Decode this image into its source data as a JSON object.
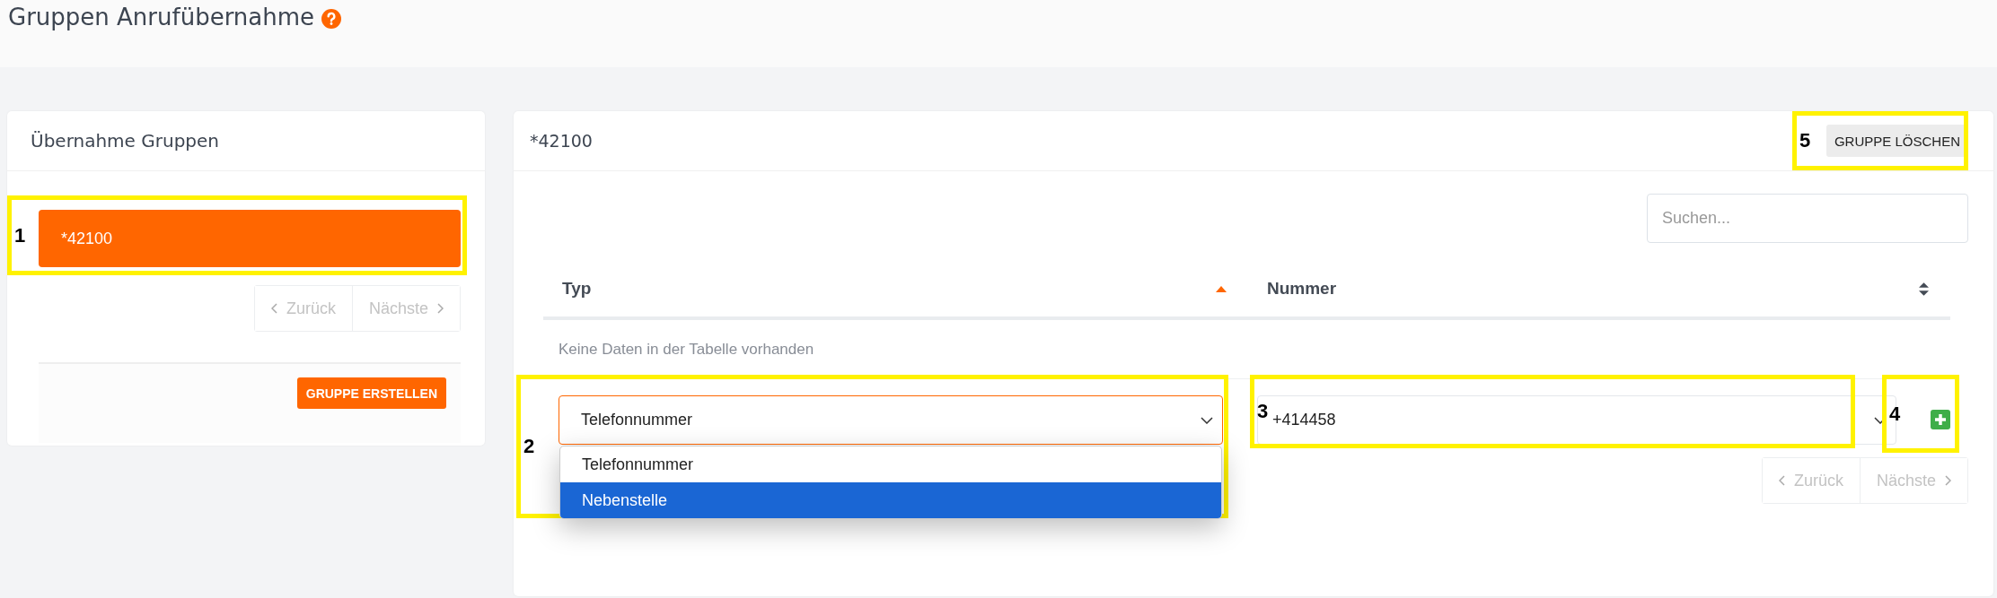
{
  "page": {
    "title": "Gruppen Anrufübernahme"
  },
  "groups_panel": {
    "title": "Übernahme Gruppen",
    "items": [
      {
        "label": "*42100",
        "selected": true
      }
    ],
    "pagination": {
      "previous": "Zurück",
      "next": "Nächste"
    },
    "create_button": "GRUPPE ERSTELLEN"
  },
  "detail_panel": {
    "title": "*42100",
    "delete_button": "GRUPPE LÖSCHEN",
    "search": {
      "placeholder": "Suchen..."
    },
    "columns": [
      {
        "label": "Typ",
        "sorted": true
      },
      {
        "label": "Nummer",
        "sorted": false
      }
    ],
    "empty_message": "Keine Daten in der Tabelle vorhanden",
    "type_select": {
      "value": "Telefonnummer",
      "expanded": true,
      "options": [
        {
          "label": "Telefonnummer",
          "highlighted": false
        },
        {
          "label": "Nebenstelle",
          "highlighted": true
        }
      ]
    },
    "number_input": {
      "value": "+414458"
    },
    "pagination": {
      "previous": "Zurück",
      "next": "Nächste"
    }
  },
  "annotations": [
    {
      "label": "1"
    },
    {
      "label": "2"
    },
    {
      "label": "3"
    },
    {
      "label": "4"
    },
    {
      "label": "5"
    }
  ]
}
